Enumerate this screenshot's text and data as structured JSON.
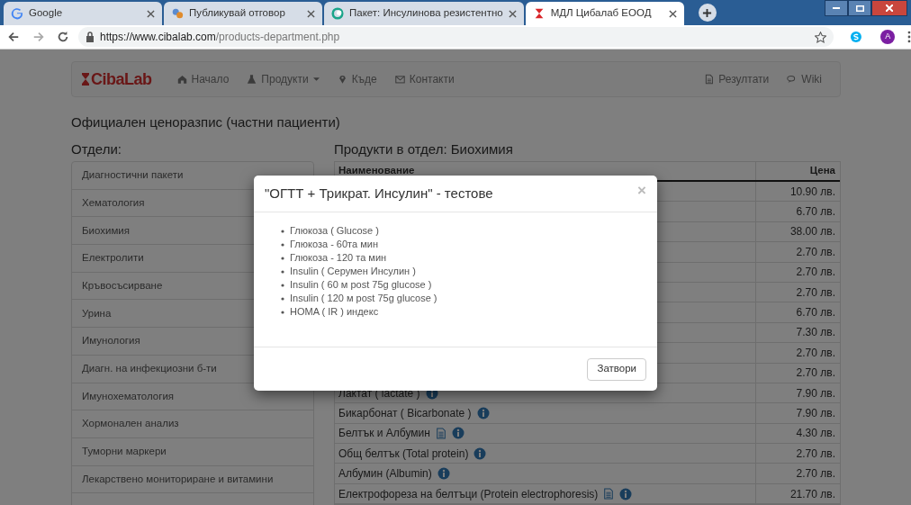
{
  "browser": {
    "tabs": [
      {
        "title": "Google",
        "selected": false
      },
      {
        "title": "Публикувай отговор",
        "selected": false
      },
      {
        "title": "Пакет: Инсулинова резистентно",
        "selected": false
      },
      {
        "title": "МДЛ Цибалаб ЕООД",
        "selected": true
      }
    ],
    "url": {
      "origin": "https://www.cibalab.com",
      "path": "/products-department.php"
    },
    "profile_initial": "A"
  },
  "navbar": {
    "brand": "CibaLab",
    "left": [
      {
        "label": "Начало",
        "kind": "link"
      },
      {
        "label": "Продукти",
        "kind": "dropdown"
      },
      {
        "label": "Къде",
        "kind": "link"
      },
      {
        "label": "Контакти",
        "kind": "link"
      }
    ],
    "right": [
      {
        "label": "Резултати"
      },
      {
        "label": "Wiki"
      }
    ]
  },
  "page_title": "Официален ценоразпис (частни пациенти)",
  "sidebar": {
    "heading": "Отдели:",
    "items": [
      "Диагностични пакети",
      "Хематология",
      "Биохимия",
      "Електролити",
      "Кръвосъсирване",
      "Урина",
      "Имунология",
      "Диагн. на инфекциозни б-ти",
      "Имунохематология",
      "Хормонален анализ",
      "Туморни маркери",
      "Лекарствено мониториране и витамини"
    ]
  },
  "products": {
    "heading": "Продукти в отдел: Биохимия",
    "columns": [
      "Наименование",
      "Цена"
    ],
    "rows": [
      {
        "price": "10.90 лв."
      },
      {
        "price": "6.70 лв."
      },
      {
        "price": "38.00 лв."
      },
      {
        "price": "2.70 лв."
      },
      {
        "price": "2.70 лв."
      },
      {
        "price": "2.70 лв."
      },
      {
        "price": "6.70 лв."
      },
      {
        "price": "7.30 лв."
      },
      {
        "price": "2.70 лв."
      },
      {
        "price": "2.70 лв."
      },
      {
        "name": "Лактат ( lactate )",
        "doc": false,
        "price": "7.90 лв."
      },
      {
        "name": "Бикарбонат ( Bicarbonate )",
        "doc": false,
        "price": "7.90 лв."
      },
      {
        "name": "Белтък и Албумин",
        "doc": true,
        "price": "4.30 лв."
      },
      {
        "name": "Общ белтък (Total protein)",
        "doc": false,
        "price": "2.70 лв."
      },
      {
        "name": "Албумин (Albumin)",
        "doc": false,
        "price": "2.70 лв."
      },
      {
        "name": "Електрофореза на белтъци (Protein electrophoresis)",
        "doc": true,
        "price": "21.70 лв."
      }
    ]
  },
  "modal": {
    "title": "\"ОГТТ + Трикрат. Инсулин\" - тестове",
    "close": "×",
    "items": [
      "Глюкоза ( Glucose )",
      "Глюкоза - 60та мин",
      "Глюкоза - 120 та мин",
      "Insulin ( Серумен Инсулин )",
      "Insulin ( 60 м post 75g glucose )",
      "Insulin ( 120 м post 75g glucose )",
      "HOMA ( IR ) индекс"
    ],
    "button": "Затвори"
  }
}
